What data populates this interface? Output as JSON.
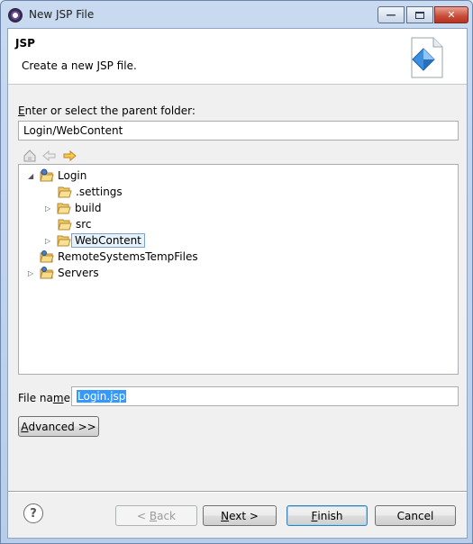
{
  "window": {
    "title": "New JSP File"
  },
  "header": {
    "title": "JSP",
    "description": "Create a new JSP file."
  },
  "parent_folder": {
    "label_prefix": "",
    "label_mnemonic": "E",
    "label_rest": "nter or select the parent folder:",
    "value": "Login/WebContent"
  },
  "tree": {
    "items": [
      {
        "label": "Login",
        "expanded": true,
        "type": "project"
      },
      {
        "label": ".settings",
        "type": "folder"
      },
      {
        "label": "build",
        "type": "folder",
        "expandable": true
      },
      {
        "label": "src",
        "type": "folder"
      },
      {
        "label": "WebContent",
        "type": "folder",
        "expandable": true,
        "selected": true
      },
      {
        "label": "RemoteSystemsTempFiles",
        "type": "project"
      },
      {
        "label": "Servers",
        "type": "project",
        "expandable": true
      }
    ]
  },
  "file_name": {
    "label_prefix": "File na",
    "label_mnemonic": "m",
    "label_rest": "e:",
    "value": "Login.jsp"
  },
  "buttons": {
    "advanced_mnemonic": "A",
    "advanced_rest": "dvanced >>",
    "back_prefix": "< ",
    "back_mnemonic": "B",
    "back_rest": "ack",
    "next_mnemonic": "N",
    "next_rest": "ext >",
    "finish_mnemonic": "F",
    "finish_rest": "inish",
    "cancel": "Cancel",
    "help": "?"
  }
}
